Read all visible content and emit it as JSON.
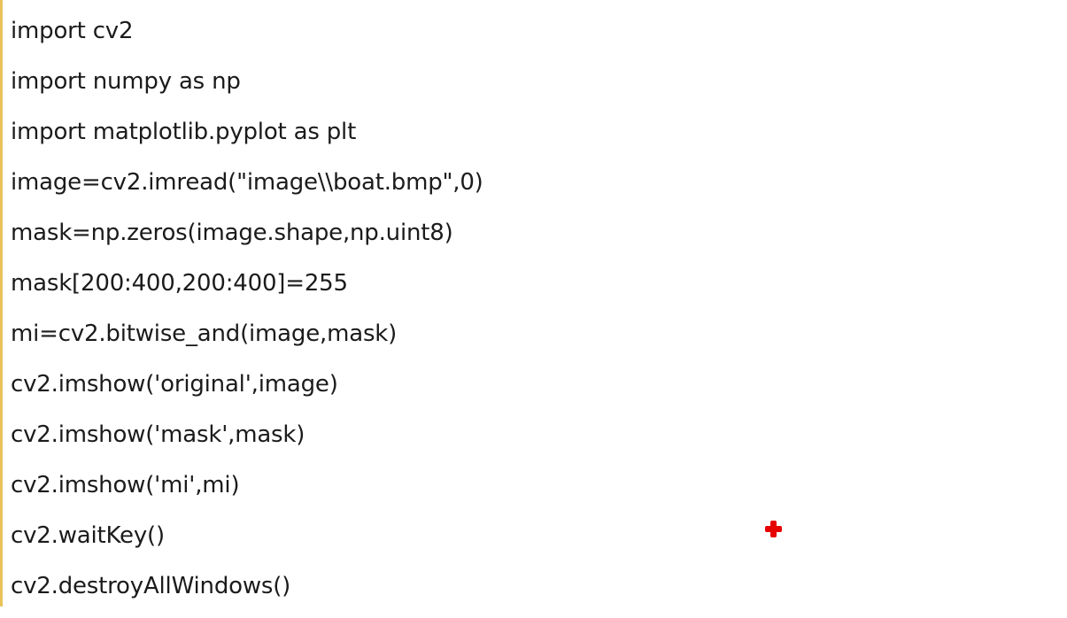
{
  "code": {
    "lines": [
      "import cv2",
      "import numpy as np",
      "import matplotlib.pyplot as plt",
      "image=cv2.imread(\"image\\\\boat.bmp\",0)",
      "mask=np.zeros(image.shape,np.uint8)",
      "mask[200:400,200:400]=255",
      "mi=cv2.bitwise_and(image,mask)",
      "cv2.imshow('original',image)",
      "cv2.imshow('mask',mask)",
      "cv2.imshow('mi',mi)",
      "cv2.waitKey()",
      "cv2.destroyAllWindows()"
    ]
  },
  "pointer": {
    "icon": "red-cross-cursor-icon",
    "color": "#e60000"
  },
  "colors": {
    "background": "#ffffff",
    "text": "#1b1b1b",
    "left_edge": "#e9c35a"
  }
}
